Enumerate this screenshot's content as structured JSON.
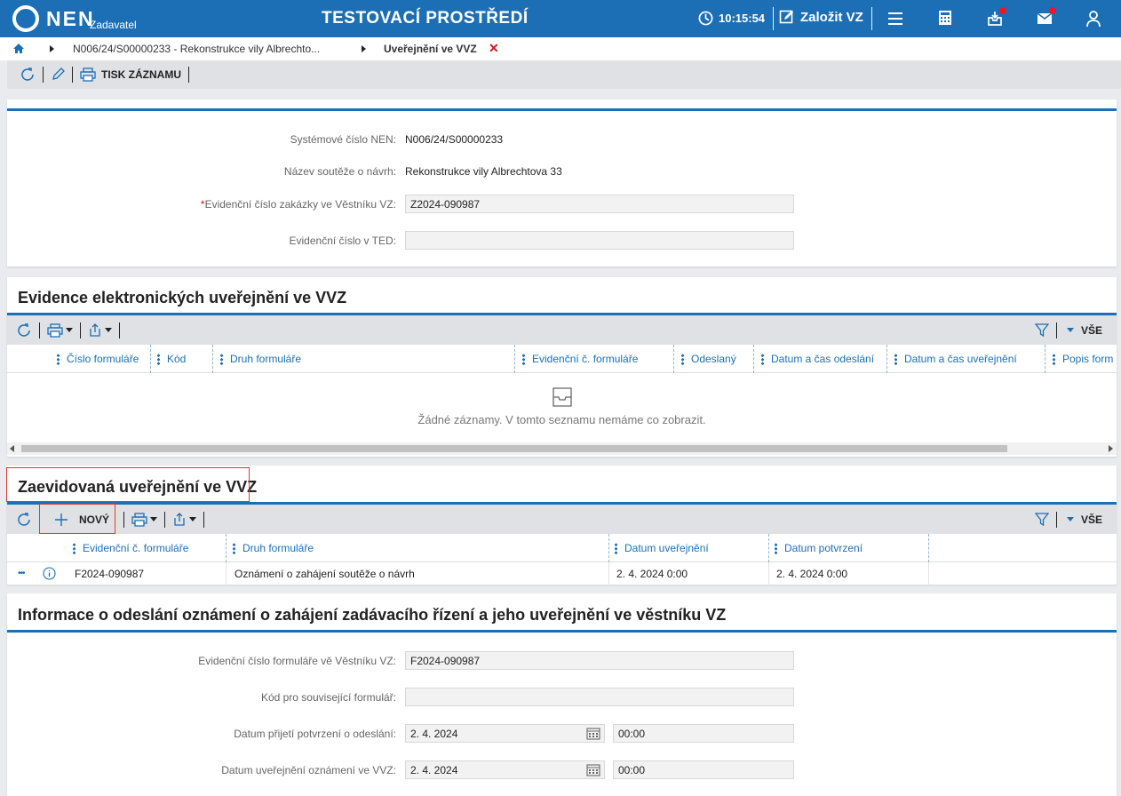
{
  "topbar": {
    "logo_text": "NEN",
    "role": "Zadavatel",
    "environment": "TESTOVACÍ PROSTŘEDÍ",
    "time": "10:15:54",
    "create_label": "Založit VZ",
    "icons": [
      "clock-icon",
      "edit-icon",
      "menu-icon",
      "calculator-icon",
      "inbox-icon",
      "mail-icon",
      "user-icon"
    ],
    "colors": {
      "bar": "#1c6fb5",
      "notification": "#e8182a"
    }
  },
  "breadcrumb": {
    "record": "N006/24/S00000233 - Rekonstrukce vily Albrechto...",
    "current": "Uveřejnění ve VVZ",
    "close": "✕"
  },
  "toolbar": {
    "print_label": "TISK ZÁZNAMU"
  },
  "basic_info": {
    "system_number": {
      "label": "Systémové číslo NEN:",
      "value": "N006/24/S00000233"
    },
    "contest_name": {
      "label": "Název soutěže o návrh:",
      "value": "Rekonstrukce vily Albrechtova 33"
    },
    "vvz_number": {
      "required": "*",
      "label": "Evidenční číslo zakázky ve Věstníku VZ:",
      "value": "Z2024-090987"
    },
    "ted_number": {
      "label": "Evidenční číslo v TED:",
      "value": ""
    }
  },
  "electronic_publications": {
    "title": "Evidence elektronických uveřejnění ve VVZ",
    "filter_all": "VŠE",
    "columns": [
      "Číslo formuláře",
      "Kód",
      "Druh formuláře",
      "Evidenční č. formuláře",
      "Odeslaný",
      "Datum a čas odeslání",
      "Datum a čas uveřejnění",
      "Popis form"
    ],
    "empty_message": "Žádné záznamy. V tomto seznamu nemáme co zobrazit."
  },
  "registered_publications": {
    "title": "Zaevidovaná uveřejnění ve VVZ",
    "new_label": "NOVÝ",
    "filter_all": "VŠE",
    "columns": [
      "Evidenční č. formuláře",
      "Druh formuláře",
      "Datum uveřejnění",
      "Datum potvrzení"
    ],
    "rows": [
      {
        "more": "•••",
        "form_number": "F2024-090987",
        "form_type": "Oznámení o zahájení soutěže o návrh",
        "published": "2. 4. 2024 0:00",
        "confirmed": "2. 4. 2024 0:00"
      }
    ]
  },
  "sending_info": {
    "title": "Informace o odeslání oznámení o zahájení zadávacího řízení a jeho uveřejnění ve věstníku VZ",
    "form_number": {
      "label": "Evidenční číslo formuláře vě Věstníku VZ:",
      "value": "F2024-090987"
    },
    "related_code": {
      "label": "Kód pro související formulář:",
      "value": ""
    },
    "confirmation_date": {
      "label": "Datum přijetí potvrzení o odeslání:",
      "date": "2. 4. 2024",
      "time": "00:00"
    },
    "publication_date": {
      "label": "Datum uveřejnění oznámení ve VVZ:",
      "date": "2. 4. 2024",
      "time": "00:00"
    }
  }
}
